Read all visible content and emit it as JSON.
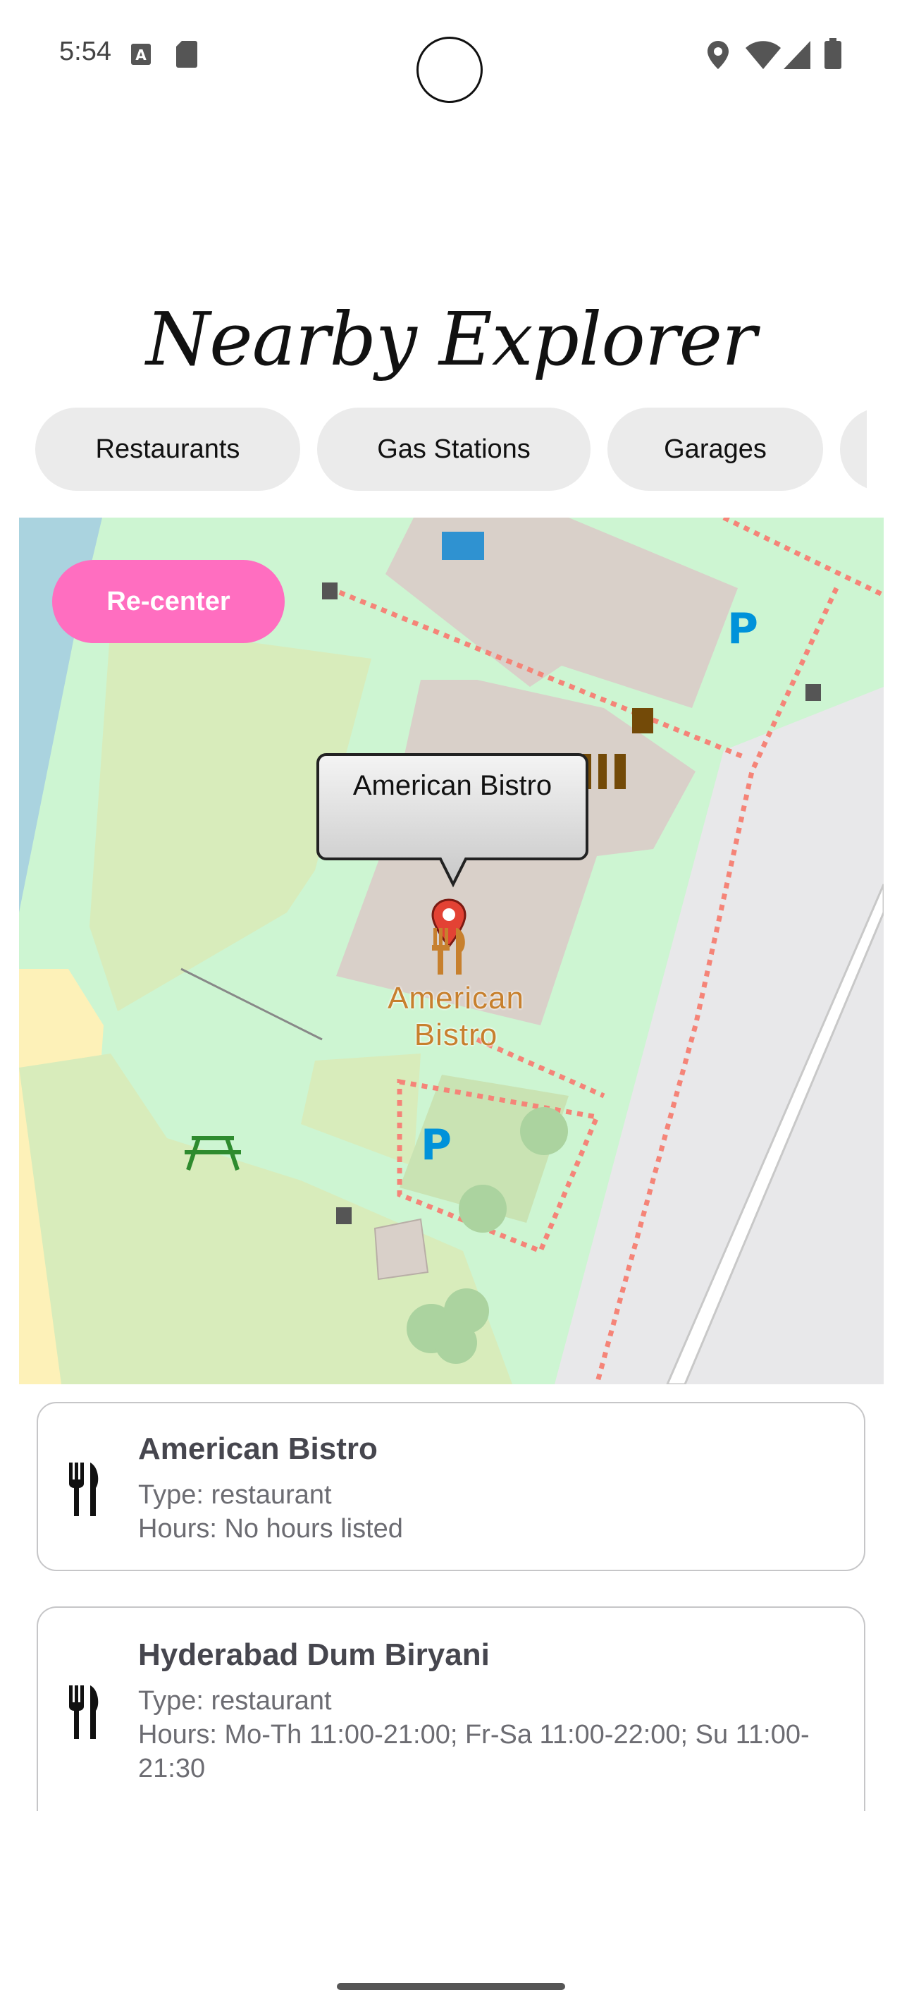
{
  "status_bar": {
    "time": "5:54",
    "icons": [
      "keyboard-a-icon",
      "sd-card-icon",
      "location-icon",
      "wifi-icon",
      "signal-icon",
      "battery-icon"
    ]
  },
  "app": {
    "title": "Nearby Explorer"
  },
  "chips": [
    {
      "label": "Restaurants"
    },
    {
      "label": "Gas Stations"
    },
    {
      "label": "Garages"
    },
    {
      "label": ""
    }
  ],
  "map": {
    "recenter_label": "Re-center",
    "marker_callout": "American Bistro",
    "map_label_line1": "American",
    "map_label_line2": "Bistro",
    "colors": {
      "grass": "#cdf5d2",
      "park": "#d8ecbb",
      "building": "#d9d0c9",
      "water": "#aad3df",
      "sand": "#fdf1b8",
      "road": "#e8e8ea",
      "path": "#f58478",
      "recenter": "#ff6ec0"
    }
  },
  "places": [
    {
      "name": "American Bistro",
      "type": "Type: restaurant",
      "hours": "Hours: No hours listed",
      "icon": "fork-knife-icon"
    },
    {
      "name": "Hyderabad Dum Biryani",
      "type": "Type: restaurant",
      "hours": "Hours: Mo-Th 11:00-21:00; Fr-Sa 11:00-22:00; Su 11:00-21:30",
      "icon": "fork-knife-icon"
    }
  ]
}
